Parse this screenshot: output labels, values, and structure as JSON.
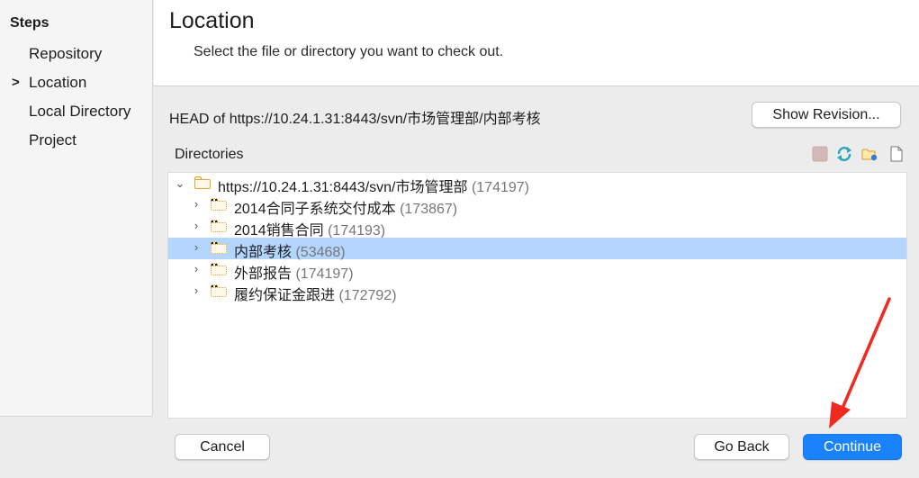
{
  "sidebar": {
    "title": "Steps",
    "steps": [
      {
        "label": "Repository"
      },
      {
        "label": "Location",
        "current": true
      },
      {
        "label": "Local Directory"
      },
      {
        "label": "Project"
      }
    ],
    "current_marker": ">"
  },
  "header": {
    "title": "Location",
    "subtitle": "Select the file or directory you want to check out."
  },
  "location": {
    "head_text": "HEAD of https://10.24.1.31:8443/svn/市场管理部/内部考核",
    "show_revision_label": "Show Revision..."
  },
  "directories": {
    "label": "Directories",
    "toolbar_icons": [
      "stop-icon",
      "refresh-icon",
      "new-folder-icon",
      "new-file-icon"
    ],
    "root": {
      "name": "https://10.24.1.31:8443/svn/市场管理部",
      "rev": "(174197)",
      "expanded": true
    },
    "items": [
      {
        "name": "2014合同子系统交付成本",
        "rev": "(173867)"
      },
      {
        "name": "2014销售合同",
        "rev": "(174193)"
      },
      {
        "name": "内部考核",
        "rev": "(53468)",
        "selected": true
      },
      {
        "name": "外部报告",
        "rev": "(174197)"
      },
      {
        "name": "履约保证金跟进",
        "rev": "(172792)"
      }
    ]
  },
  "footer": {
    "cancel_label": "Cancel",
    "back_label": "Go Back",
    "continue_label": "Continue"
  },
  "colors": {
    "accent": "#1a82fb",
    "selection": "#b4d5fe",
    "folder": "#e3a43a",
    "annotation_arrow": "#f02a1f"
  }
}
